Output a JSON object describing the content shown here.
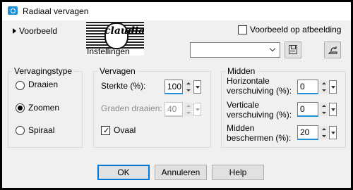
{
  "window": {
    "title": "Radiaal vervagen"
  },
  "preview": {
    "label": "Voorbeeld",
    "settings_label": "Instellingen",
    "logo_text": "claudia"
  },
  "preview_on_image": {
    "label": "Voorbeeld op afbeelding",
    "checked": false
  },
  "preset": {
    "value": ""
  },
  "icons": {
    "title": "dialog-app-icon",
    "save": "save-preset-icon",
    "reset": "reset-icon"
  },
  "type_group": {
    "title": "Vervagingstype",
    "options": [
      {
        "label": "Draaien",
        "selected": false
      },
      {
        "label": "Zoomen",
        "selected": true
      },
      {
        "label": "Spiraal",
        "selected": false
      }
    ]
  },
  "blur_group": {
    "title": "Vervagen",
    "strength": {
      "label": "Sterkte (%):",
      "value": "100"
    },
    "rotation": {
      "label": "Graden draaien:",
      "value": "40",
      "disabled": true
    },
    "oval": {
      "label": "Ovaal",
      "checked": true
    }
  },
  "center_group": {
    "title": "Midden",
    "h_offset": {
      "label_line1": "Horizontale",
      "label_line2": "verschuiving (%):",
      "value": "0"
    },
    "v_offset": {
      "label_line1": "Verticale",
      "label_line2": "verschuiving (%):",
      "value": "0"
    },
    "protect": {
      "label_line1": "Midden",
      "label_line2": "beschermen (%):",
      "value": "20"
    }
  },
  "buttons": {
    "ok": "OK",
    "cancel": "Annuleren",
    "help": "Help"
  },
  "colors": {
    "accent": "#1e90d8",
    "focus": "#0078d7",
    "background": "#f0f0f0"
  }
}
